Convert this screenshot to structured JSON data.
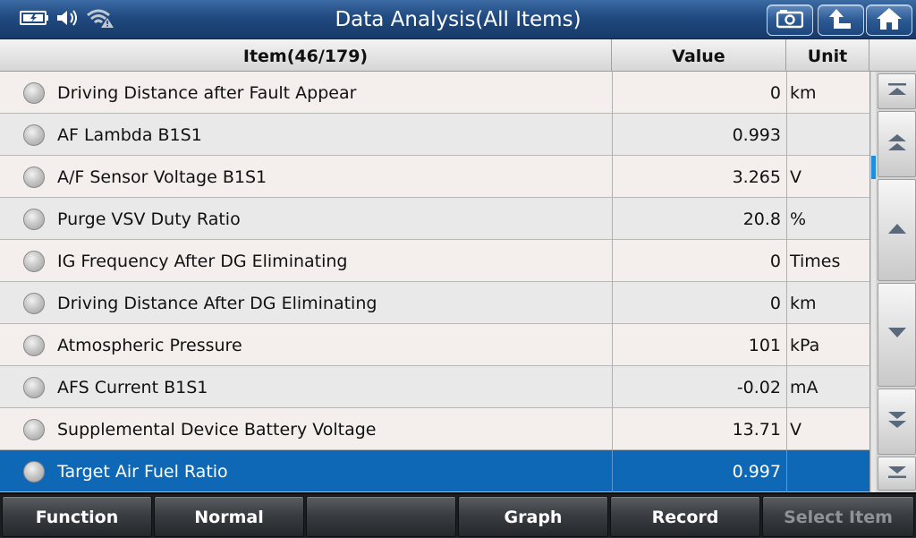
{
  "window": {
    "title": "Data Analysis(All Items)"
  },
  "status_icons": [
    "battery-charging-icon",
    "speaker-icon",
    "wifi-warning-icon"
  ],
  "title_buttons": [
    {
      "name": "screenshot-button",
      "icon": "camera-icon"
    },
    {
      "name": "back-button",
      "icon": "return-arrow-icon"
    },
    {
      "name": "home-button",
      "icon": "home-icon"
    }
  ],
  "table": {
    "headers": {
      "item": "Item(46/179)",
      "value": "Value",
      "unit": "Unit"
    },
    "rows": [
      {
        "name": "Driving Distance after Fault Appear",
        "value": "0",
        "unit": "km"
      },
      {
        "name": "AF Lambda B1S1",
        "value": "0.993",
        "unit": ""
      },
      {
        "name": "A/F Sensor Voltage B1S1",
        "value": "3.265",
        "unit": "V"
      },
      {
        "name": "Purge VSV Duty Ratio",
        "value": "20.8",
        "unit": "%"
      },
      {
        "name": "IG Frequency After DG Eliminating",
        "value": "0",
        "unit": "Times"
      },
      {
        "name": "Driving Distance After DG Eliminating",
        "value": "0",
        "unit": "km"
      },
      {
        "name": "Atmospheric Pressure",
        "value": "101",
        "unit": "kPa"
      },
      {
        "name": "AFS Current B1S1",
        "value": "-0.02",
        "unit": "mA"
      },
      {
        "name": "Supplemental Device Battery Voltage",
        "value": "13.71",
        "unit": "V"
      },
      {
        "name": "Target Air Fuel Ratio",
        "value": "0.997",
        "unit": ""
      }
    ],
    "selected_row": 9
  },
  "scroll_buttons": [
    "scroll-top-icon",
    "page-up-icon",
    "up-icon",
    "down-icon",
    "page-down-icon",
    "scroll-bottom-icon"
  ],
  "toolbar": {
    "function_label": "Function",
    "normal_label": "Normal",
    "empty_label": "",
    "graph_label": "Graph",
    "record_label": "Record",
    "select_item_label": "Select Item"
  },
  "colors": {
    "title_bar": "#204a80",
    "selected_row": "#0f68b6",
    "scroll_thumb": "#1f8ee0"
  }
}
